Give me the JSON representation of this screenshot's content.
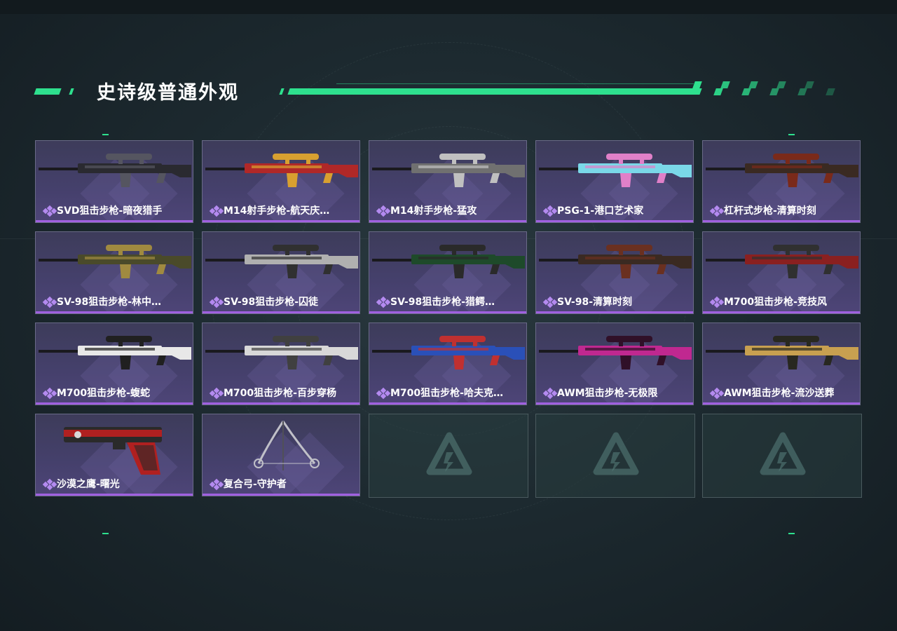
{
  "section": {
    "title": "史诗级普通外观"
  },
  "colors": {
    "accent": "#2ee08e",
    "rarity": "#a060e0",
    "card_bg": "#43406a",
    "empty_bg": "#28403e"
  },
  "items": [
    {
      "name": "SVD狙击步枪-暗夜猎手",
      "icon": "sniper-rifle-icon",
      "palette": [
        "#2a2a30",
        "#555560"
      ]
    },
    {
      "name": "M14射手步枪-航天庆…",
      "icon": "rifle-icon",
      "palette": [
        "#b02828",
        "#d8a030"
      ]
    },
    {
      "name": "M14射手步枪-猛攻",
      "icon": "rifle-icon",
      "palette": [
        "#707070",
        "#c0c0c0"
      ]
    },
    {
      "name": "PSG-1-港口艺术家",
      "icon": "sniper-rifle-icon",
      "palette": [
        "#7ad8e8",
        "#e080c8"
      ]
    },
    {
      "name": "杠杆式步枪-清算时刻",
      "icon": "lever-rifle-icon",
      "palette": [
        "#3a2a22",
        "#7a2a1a"
      ]
    },
    {
      "name": "SV-98狙击步枪-林中…",
      "icon": "sniper-rifle-icon",
      "palette": [
        "#4a4a2a",
        "#a08a40"
      ]
    },
    {
      "name": "SV-98狙击步枪-囚徒",
      "icon": "sniper-rifle-icon",
      "palette": [
        "#b0b0b0",
        "#303030"
      ]
    },
    {
      "name": "SV-98狙击步枪-猎鳄…",
      "icon": "sniper-rifle-icon",
      "palette": [
        "#1e4a2a",
        "#2a2a2a"
      ]
    },
    {
      "name": "SV-98-清算时刻",
      "icon": "sniper-rifle-icon",
      "palette": [
        "#3a2a22",
        "#6a3020"
      ]
    },
    {
      "name": "M700狙击步枪-竞技风",
      "icon": "sniper-rifle-icon",
      "palette": [
        "#8a2020",
        "#303030"
      ]
    },
    {
      "name": "M700狙击步枪-蝮蛇",
      "icon": "sniper-rifle-icon",
      "palette": [
        "#e8e8e8",
        "#202020"
      ]
    },
    {
      "name": "M700狙击步枪-百步穿杨",
      "icon": "sniper-rifle-icon",
      "palette": [
        "#d8d8d8",
        "#404040"
      ]
    },
    {
      "name": "M700狙击步枪-哈夫克…",
      "icon": "sniper-rifle-icon",
      "palette": [
        "#2a50b8",
        "#c03030"
      ]
    },
    {
      "name": "AWM狙击步枪-无极限",
      "icon": "sniper-rifle-icon",
      "palette": [
        "#c02890",
        "#301028"
      ]
    },
    {
      "name": "AWM狙击步枪-流沙送葬",
      "icon": "sniper-rifle-icon",
      "palette": [
        "#c8a050",
        "#282820"
      ]
    },
    {
      "name": "沙漠之鹰-曙光",
      "icon": "pistol-icon",
      "palette": [
        "#b02020",
        "#2a2a2a"
      ]
    },
    {
      "name": "复合弓-守护者",
      "icon": "compound-bow-icon",
      "palette": [
        "#c0c0c8",
        "#505058"
      ]
    }
  ]
}
